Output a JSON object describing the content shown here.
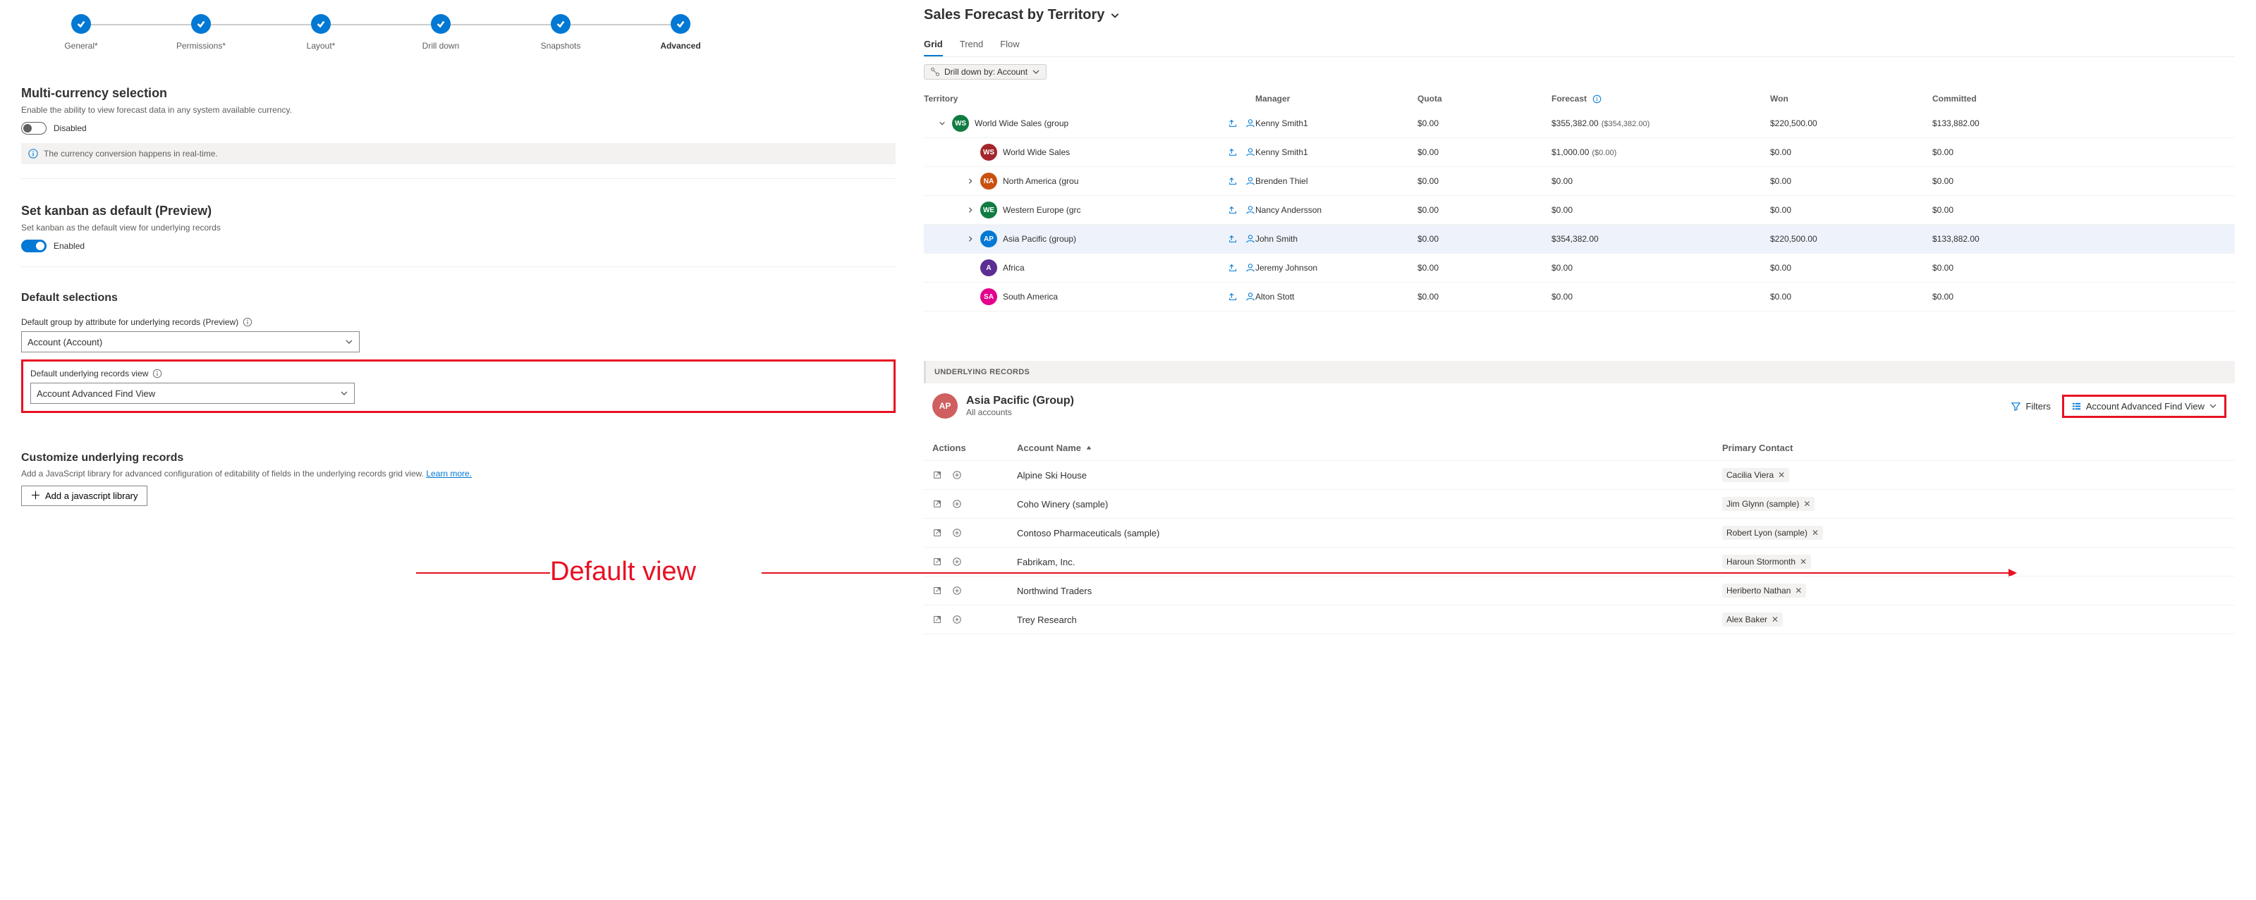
{
  "steps": [
    "General*",
    "Permissions*",
    "Layout*",
    "Drill down",
    "Snapshots",
    "Advanced"
  ],
  "active_step_index": 5,
  "multi_currency": {
    "title": "Multi-currency selection",
    "desc": "Enable the ability to view forecast data in any system available currency.",
    "toggle_state": "Disabled",
    "info": "The currency conversion happens in real-time."
  },
  "kanban": {
    "title": "Set kanban as default (Preview)",
    "desc": "Set kanban as the default view for underlying records",
    "toggle_state": "Enabled"
  },
  "defaults": {
    "title": "Default selections",
    "group_label": "Default group by attribute for underlying records (Preview)",
    "group_value": "Account (Account)",
    "view_label": "Default underlying records view",
    "view_value": "Account Advanced Find View"
  },
  "customize": {
    "title": "Customize underlying records",
    "desc_pre": "Add a JavaScript library for advanced configuration of editability of fields in the underlying records grid view. ",
    "learn": "Learn more.",
    "btn": "Add a javascript library"
  },
  "annotation": "Default view",
  "forecast": {
    "title": "Sales Forecast by Territory",
    "tabs": [
      "Grid",
      "Trend",
      "Flow"
    ],
    "active_tab": 0,
    "drilldown": "Drill down by: Account",
    "columns": [
      "Territory",
      "Manager",
      "Quota",
      "Forecast",
      "Won",
      "Committed"
    ],
    "rows": [
      {
        "indent": 0,
        "caret": "down",
        "badge": "WS",
        "color": "#107c41",
        "name": "World Wide Sales (group",
        "manager": "Kenny Smith1",
        "quota": "$0.00",
        "forecast": "$355,382.00",
        "forecast_sub": "($354,382.00)",
        "won": "$220,500.00",
        "committed": "$133,882.00"
      },
      {
        "indent": 1,
        "caret": "",
        "badge": "WS",
        "color": "#a4262c",
        "name": "World Wide Sales",
        "manager": "Kenny Smith1",
        "quota": "$0.00",
        "forecast": "$1,000.00",
        "forecast_sub": "($0.00)",
        "won": "$0.00",
        "committed": "$0.00"
      },
      {
        "indent": 1,
        "caret": "right",
        "badge": "NA",
        "color": "#ca5010",
        "name": "North America (grou",
        "manager": "Brenden Thiel",
        "quota": "$0.00",
        "forecast": "$0.00",
        "forecast_sub": "",
        "won": "$0.00",
        "committed": "$0.00"
      },
      {
        "indent": 1,
        "caret": "right",
        "badge": "WE",
        "color": "#107c41",
        "name": "Western Europe (grc",
        "manager": "Nancy Andersson",
        "quota": "$0.00",
        "forecast": "$0.00",
        "forecast_sub": "",
        "won": "$0.00",
        "committed": "$0.00"
      },
      {
        "indent": 1,
        "caret": "right",
        "badge": "AP",
        "color": "#0078d4",
        "name": "Asia Pacific (group)",
        "manager": "John Smith",
        "quota": "$0.00",
        "forecast": "$354,382.00",
        "forecast_sub": "",
        "won": "$220,500.00",
        "committed": "$133,882.00",
        "highlight": true
      },
      {
        "indent": 1,
        "caret": "",
        "badge": "A",
        "color": "#5c2e91",
        "name": "Africa",
        "manager": "Jeremy Johnson",
        "quota": "$0.00",
        "forecast": "$0.00",
        "forecast_sub": "",
        "won": "$0.00",
        "committed": "$0.00"
      },
      {
        "indent": 1,
        "caret": "",
        "badge": "SA",
        "color": "#e3008c",
        "name": "South America",
        "manager": "Alton Stott",
        "quota": "$0.00",
        "forecast": "$0.00",
        "forecast_sub": "",
        "won": "$0.00",
        "committed": "$0.00"
      }
    ]
  },
  "underlying": {
    "bar": "UNDERLYING RECORDS",
    "avatar": "AP",
    "title": "Asia Pacific (Group)",
    "sub": "All accounts",
    "filters": "Filters",
    "view": "Account Advanced Find View",
    "columns": [
      "Actions",
      "Account Name",
      "Primary Contact"
    ],
    "rows": [
      {
        "name": "Alpine Ski House",
        "contact": "Cacilia Viera"
      },
      {
        "name": "Coho Winery (sample)",
        "contact": "Jim Glynn (sample)"
      },
      {
        "name": "Contoso Pharmaceuticals (sample)",
        "contact": "Robert Lyon (sample)"
      },
      {
        "name": "Fabrikam, Inc.",
        "contact": "Haroun Stormonth"
      },
      {
        "name": "Northwind Traders",
        "contact": "Heriberto Nathan"
      },
      {
        "name": "Trey Research",
        "contact": "Alex Baker"
      }
    ]
  }
}
